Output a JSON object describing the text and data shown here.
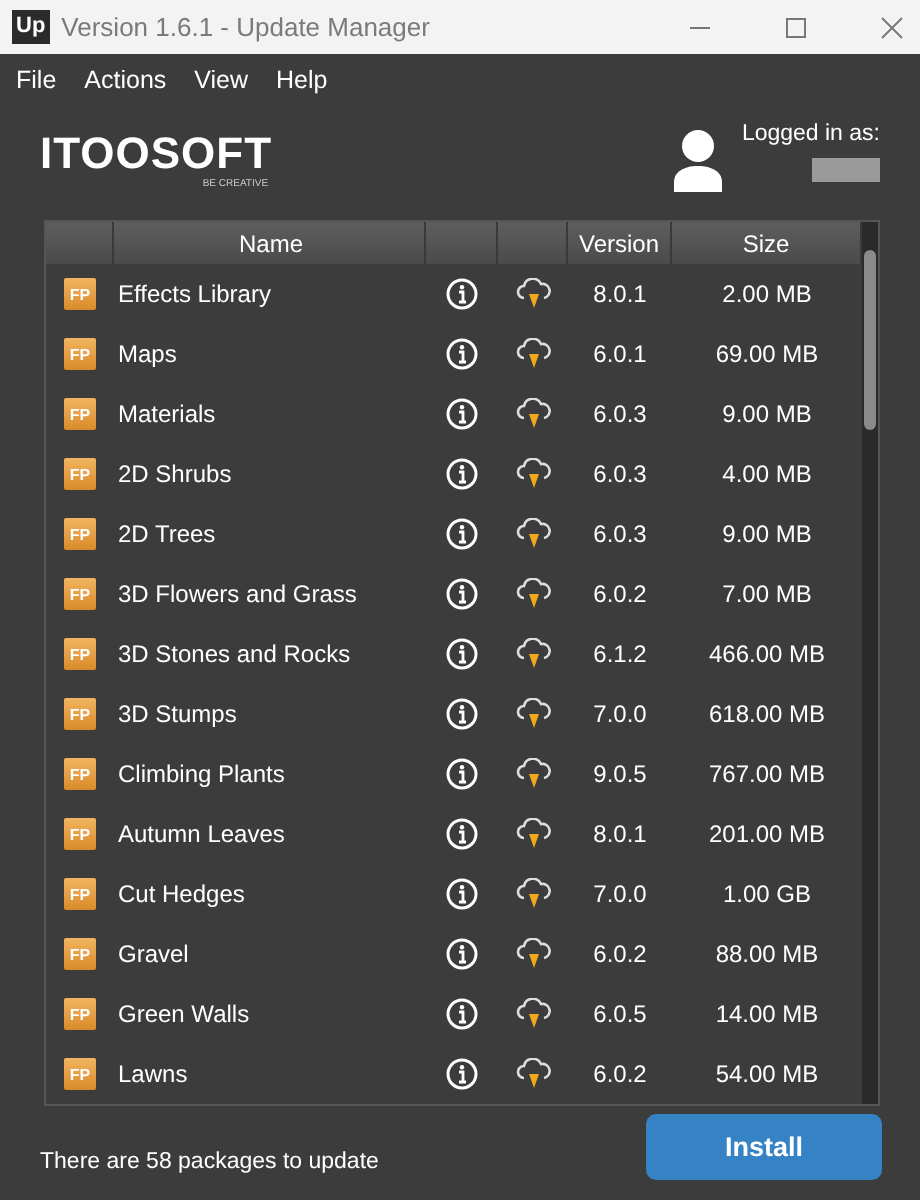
{
  "window": {
    "app_badge": "Up",
    "title": "Version 1.6.1 - Update Manager"
  },
  "menu": [
    "File",
    "Actions",
    "View",
    "Help"
  ],
  "logo": {
    "name": "ITOOSOFT",
    "tagline": "BE CREATIVE"
  },
  "account": {
    "label": "Logged in as:"
  },
  "table": {
    "columns": [
      "",
      "Name",
      "",
      "",
      "Version",
      "Size"
    ],
    "rows": [
      {
        "badge": "FP",
        "name": "Effects Library",
        "version": "8.0.1",
        "size": "2.00 MB"
      },
      {
        "badge": "FP",
        "name": "Maps",
        "version": "6.0.1",
        "size": "69.00 MB"
      },
      {
        "badge": "FP",
        "name": "Materials",
        "version": "6.0.3",
        "size": "9.00 MB"
      },
      {
        "badge": "FP",
        "name": "2D Shrubs",
        "version": "6.0.3",
        "size": "4.00 MB"
      },
      {
        "badge": "FP",
        "name": "2D Trees",
        "version": "6.0.3",
        "size": "9.00 MB"
      },
      {
        "badge": "FP",
        "name": "3D Flowers and Grass",
        "version": "6.0.2",
        "size": "7.00 MB"
      },
      {
        "badge": "FP",
        "name": "3D Stones and Rocks",
        "version": "6.1.2",
        "size": "466.00 MB"
      },
      {
        "badge": "FP",
        "name": "3D Stumps",
        "version": "7.0.0",
        "size": "618.00 MB"
      },
      {
        "badge": "FP",
        "name": "Climbing Plants",
        "version": "9.0.5",
        "size": "767.00 MB"
      },
      {
        "badge": "FP",
        "name": "Autumn Leaves",
        "version": "8.0.1",
        "size": "201.00 MB"
      },
      {
        "badge": "FP",
        "name": "Cut Hedges",
        "version": "7.0.0",
        "size": "1.00 GB"
      },
      {
        "badge": "FP",
        "name": "Gravel",
        "version": "6.0.2",
        "size": "88.00 MB"
      },
      {
        "badge": "FP",
        "name": "Green Walls",
        "version": "6.0.5",
        "size": "14.00 MB"
      },
      {
        "badge": "FP",
        "name": "Lawns",
        "version": "6.0.2",
        "size": "54.00 MB"
      }
    ]
  },
  "footer": {
    "status": "There are 58 packages to update",
    "button": "Install"
  }
}
